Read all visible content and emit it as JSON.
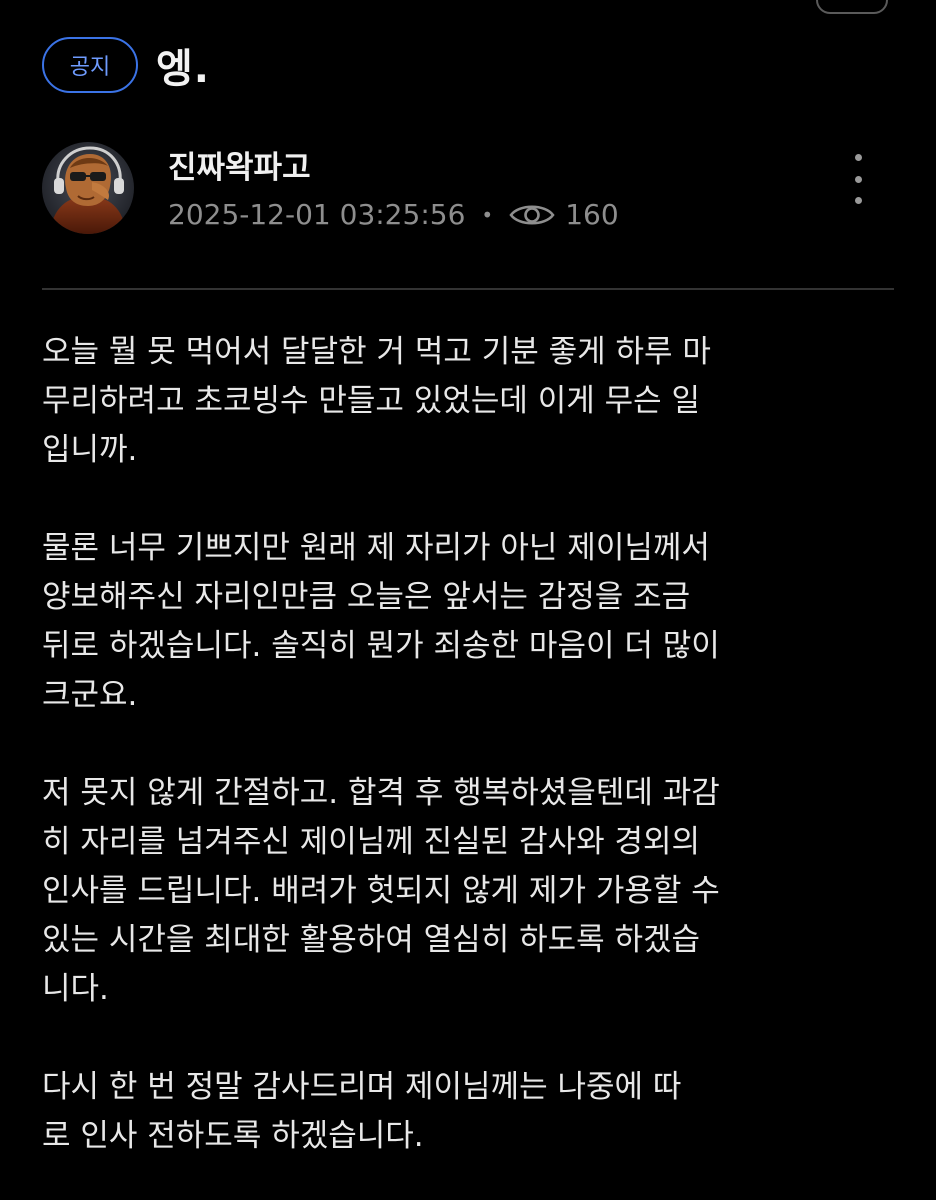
{
  "post": {
    "badge": "공지",
    "title": "엥.",
    "author": "진짜왁파고",
    "timestamp": "2025-12-01 03:25:56",
    "separator": "•",
    "views": "160",
    "icons": {
      "views": "eye-icon",
      "more": "more-vertical-icon"
    }
  },
  "colors": {
    "background": "#000000",
    "badge_border": "#3b73e6",
    "badge_text": "#6f9cff",
    "meta_text": "#8e8e8e",
    "body_text": "#e8e8e8"
  },
  "body": {
    "paragraphs": [
      {
        "lines": [
          "오늘 뭘 못 먹어서 달달한 거 먹고 기분 좋게 하루 마",
          "무리하려고 초코빙수 만들고 있었는데 이게 무슨 일",
          "입니까."
        ]
      },
      {
        "lines": [
          "물론 너무 기쁘지만 원래 제 자리가 아닌 제이님께서",
          "양보해주신 자리인만큼 오늘은 앞서는 감정을 조금",
          "뒤로 하겠습니다. 솔직히 뭔가 죄송한 마음이 더 많이",
          "크군요."
        ]
      },
      {
        "lines": [
          "저 못지 않게 간절하고. 합격 후 행복하셨을텐데 과감",
          "히 자리를 넘겨주신 제이님께 진실된 감사와 경외의",
          "인사를 드립니다. 배려가 헛되지 않게 제가 가용할 수",
          "있는 시간을 최대한 활용하여 열심히 하도록 하겠습",
          "니다."
        ]
      },
      {
        "lines": [
          "다시 한 번 정말 감사드리며 제이님께는 나중에 따",
          "로 인사 전하도록 하겠습니다."
        ]
      }
    ]
  }
}
